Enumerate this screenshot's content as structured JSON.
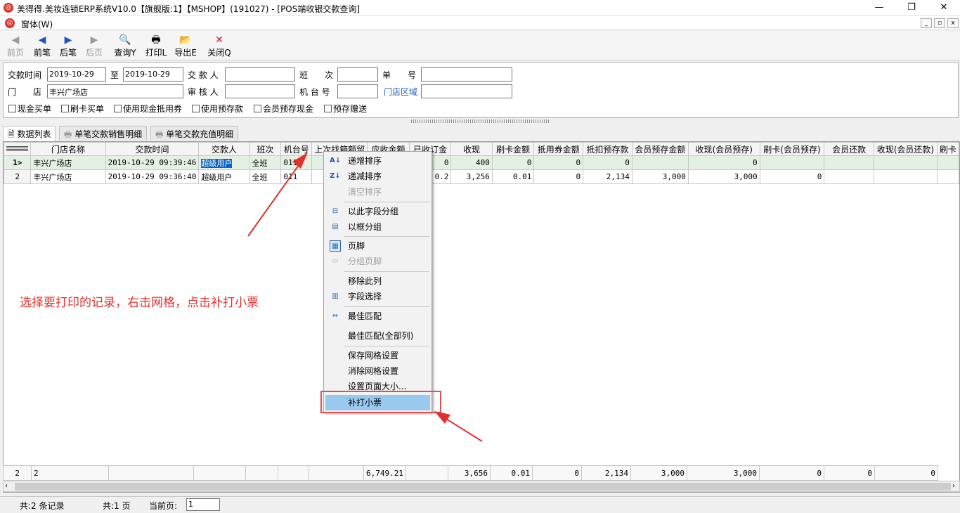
{
  "window": {
    "title": "美得得.美妆连锁ERP系统V10.0【旗舰版:1】【MSHOP】(191027) - [POS端收银交款查询]",
    "minimize": "—",
    "maximize": "❐",
    "close": "✕"
  },
  "menu": {
    "window_menu": "窗体(W)",
    "mdi_min": "_",
    "mdi_restore": "▫",
    "mdi_close": "x"
  },
  "toolbar": {
    "items": [
      {
        "label": "前页",
        "icon": "◀",
        "disabled": true
      },
      {
        "label": "前笔",
        "icon": "◀",
        "disabled": false
      },
      {
        "label": "后笔",
        "icon": "▶",
        "disabled": false
      },
      {
        "label": "后页",
        "icon": "▶",
        "disabled": true
      },
      {
        "label": "查询Y",
        "icon": "🔍",
        "disabled": false
      },
      {
        "label": "打印L",
        "icon": "🖶",
        "disabled": false
      },
      {
        "label": "导出E",
        "icon": "📂",
        "disabled": false
      },
      {
        "label": "关闭Q",
        "icon": "✕",
        "disabled": false
      }
    ]
  },
  "filter": {
    "date_label": "交款时间",
    "date_from": "2019-10-29",
    "to_label": "至",
    "date_to": "2019-10-29",
    "payer_label": "交 款 人",
    "payer_value": "",
    "shift_label": "班　　次",
    "shift_value": "",
    "order_label": "单　　号",
    "order_value": "",
    "store_label": "门　　店",
    "store_value": "丰兴广场店",
    "auditor_label": "审 核 人",
    "auditor_value": "",
    "terminal_label": "机 台 号",
    "terminal_value": "",
    "region_label": "门店区域",
    "region_value": "",
    "checkboxes": [
      "现金买单",
      "刷卡买单",
      "使用现金抵用券",
      "使用预存款",
      "会员预存现金",
      "预存赠送"
    ]
  },
  "tabs": [
    "数据列表",
    "单笔交款销售明细",
    "单笔交款充值明细"
  ],
  "grid": {
    "headers": [
      "门店名称",
      "交款时间",
      "交款人",
      "班次",
      "机台号",
      "上次找箱额留",
      "应收金额",
      "已收订金",
      "收现",
      "刷卡金额",
      "抵用券金额",
      "抵扣预存款",
      "会员预存金额",
      "收现(会员预存)",
      "刷卡(会员预存)",
      "会员还款",
      "收现(会员还款)",
      "刷卡"
    ],
    "rows": [
      {
        "indicator": "1>",
        "cells": [
          "丰兴广场店",
          "2019-10-29 09:39:46",
          "超级用户",
          "全班",
          "011",
          "",
          "",
          "0",
          "400",
          "0",
          "0",
          "0",
          "",
          "0",
          "",
          "",
          "",
          ""
        ]
      },
      {
        "indicator": "2",
        "cells": [
          "丰兴广场店",
          "2019-10-29 09:36:40",
          "超级用户",
          "全班",
          "011",
          "",
          "",
          "0.2",
          "3,256",
          "0.01",
          "0",
          "2,134",
          "3,000",
          "3,000",
          "0",
          "",
          "",
          ""
        ]
      }
    ],
    "footer": [
      "2",
      "2",
      "",
      "",
      "",
      "",
      "",
      "6,749.21",
      "",
      "3,656",
      "0.01",
      "0",
      "2,134",
      "3,000",
      "3,000",
      "0",
      "0",
      "0"
    ]
  },
  "context_menu": {
    "items": [
      "递增排序",
      "递减排序",
      "清空排序",
      "以此字段分组",
      "以框分组",
      "页脚",
      "分组页脚",
      "移除此列",
      "字段选择",
      "最佳匹配",
      "最佳匹配(全部列)",
      "保存网格设置",
      "消除网格设置",
      "设置页面大小...",
      "补打小票"
    ]
  },
  "annotation": "选择要打印的记录，右击网格，点击补打小票",
  "status": {
    "records": "共:2 条记录",
    "pages": "共:1 页",
    "current_label": "当前页:",
    "current_value": "1"
  }
}
